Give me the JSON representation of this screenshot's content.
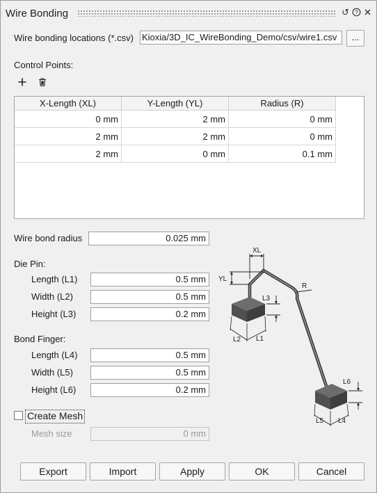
{
  "window": {
    "title": "Wire Bonding"
  },
  "titlebar_icons": [
    "reset-icon",
    "help-icon",
    "close-icon"
  ],
  "locations": {
    "label": "Wire bonding locations (*.csv)",
    "value": "Kioxia/3D_IC_WireBonding_Demo/csv/wire1.csv",
    "browse_label": "..."
  },
  "control_points": {
    "label": "Control Points:",
    "add_icon": "plus-icon",
    "delete_icon": "trash-icon",
    "columns": [
      "X-Length (XL)",
      "Y-Length (YL)",
      "Radius (R)"
    ],
    "rows": [
      [
        "0 mm",
        "2 mm",
        "0 mm"
      ],
      [
        "2 mm",
        "2 mm",
        "0 mm"
      ],
      [
        "2 mm",
        "0 mm",
        "0.1 mm"
      ]
    ]
  },
  "wire_bond_radius": {
    "label": "Wire bond radius",
    "value": "0.025 mm"
  },
  "die_pin": {
    "label": "Die Pin:",
    "length": {
      "label": "Length (L1)",
      "value": "0.5 mm"
    },
    "width": {
      "label": "Width (L2)",
      "value": "0.5 mm"
    },
    "height": {
      "label": "Height (L3)",
      "value": "0.2 mm"
    }
  },
  "bond_finger": {
    "label": "Bond Finger:",
    "length": {
      "label": "Length (L4)",
      "value": "0.5 mm"
    },
    "width": {
      "label": "Width (L5)",
      "value": "0.5 mm"
    },
    "height": {
      "label": "Height (L6)",
      "value": "0.2 mm"
    }
  },
  "create_mesh": {
    "label": "Create Mesh",
    "checked": false
  },
  "mesh_size": {
    "label": "Mesh size",
    "value": "0 mm"
  },
  "diagram_labels": {
    "xl": "XL",
    "yl": "YL",
    "r": "R",
    "l1": "L1",
    "l2": "L2",
    "l3": "L3",
    "l4": "L4",
    "l5": "L5",
    "l6": "L6"
  },
  "buttons": {
    "export": "Export",
    "import": "Import",
    "apply": "Apply",
    "ok": "OK",
    "cancel": "Cancel"
  }
}
